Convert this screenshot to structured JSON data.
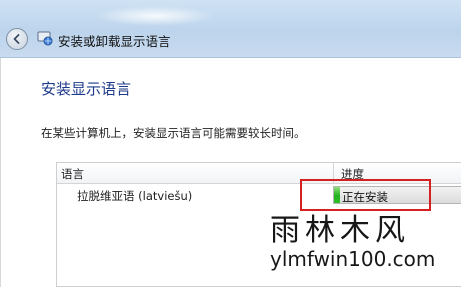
{
  "window": {
    "title": "安装或卸载显示语言"
  },
  "page": {
    "heading": "安装显示语言",
    "description": "在某些计算机上，安装显示语言可能需要较长时间。"
  },
  "list": {
    "columns": [
      "语言",
      "进度"
    ],
    "rows": [
      {
        "language": "拉脱维亚语 (latviešu)",
        "status": "正在安装",
        "progress": 0.05
      }
    ]
  },
  "watermark": {
    "name": "雨林木风",
    "url": "ylmfwin100.com"
  },
  "colors": {
    "heading": "#1e3a8a",
    "progress_green": "#22b21e",
    "highlight_red": "#d42020"
  },
  "icons": [
    "back-arrow-icon",
    "language-app-icon"
  ]
}
